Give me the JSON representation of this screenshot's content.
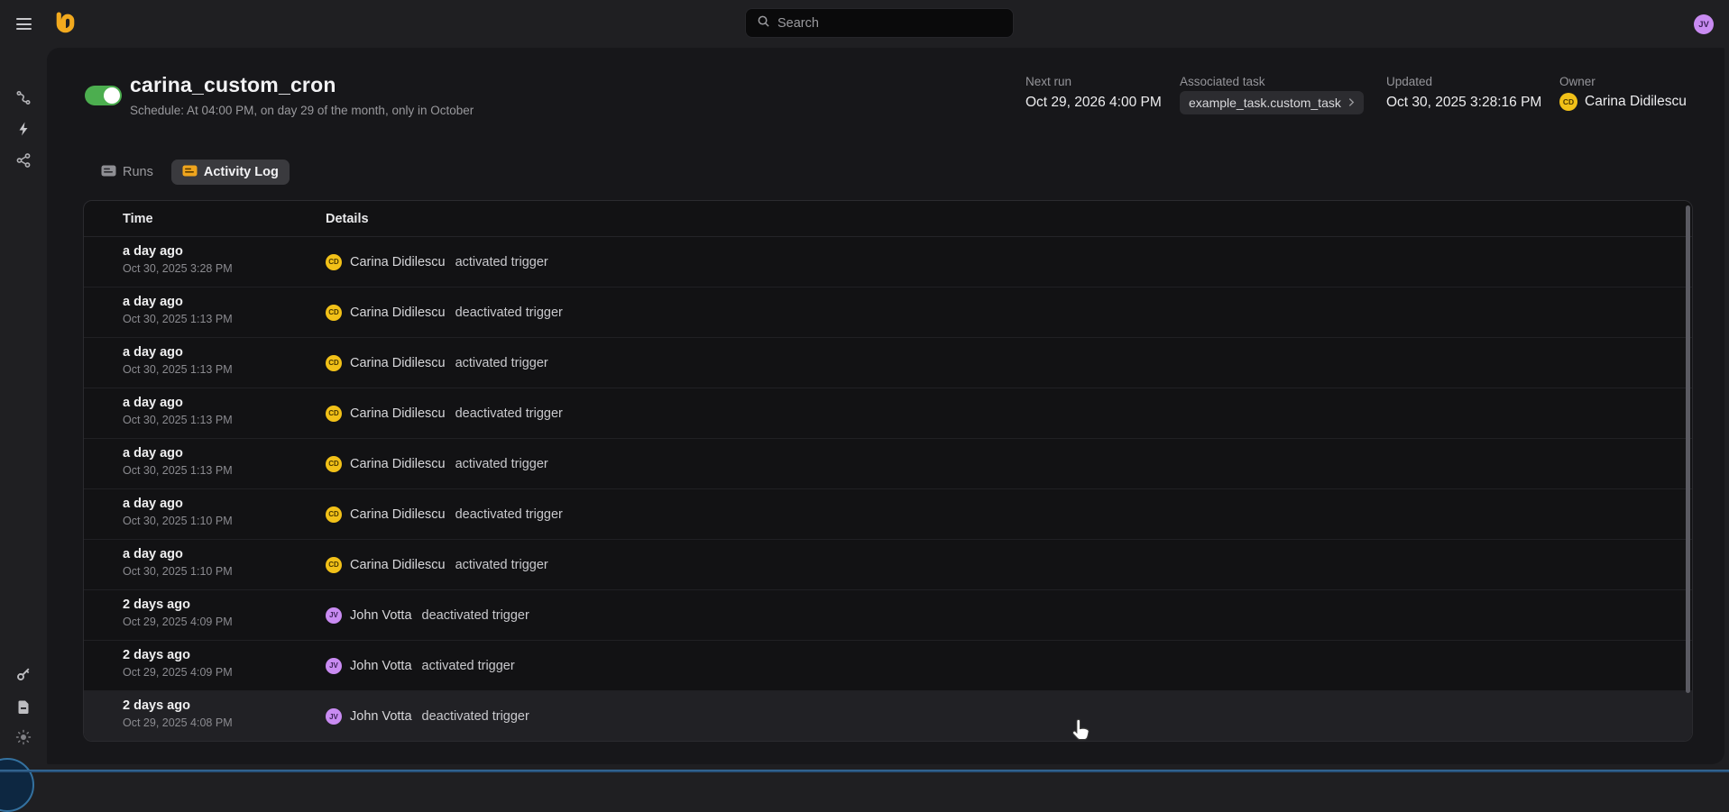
{
  "topbar": {
    "search_placeholder": "Search",
    "user_initials": "JV"
  },
  "sidebar": {
    "top_icons": [
      "route-icon",
      "lightning-icon",
      "share-icon"
    ],
    "bottom_icons": [
      "key-icon",
      "document-icon",
      "sun-icon"
    ]
  },
  "page": {
    "title": "carina_custom_cron",
    "schedule": "Schedule: At 04:00 PM, on day 29 of the month, only in October",
    "trigger_enabled": true,
    "meta": {
      "next_run_label": "Next run",
      "next_run": "Oct 29, 2026 4:00 PM",
      "associated_task_label": "Associated task",
      "associated_task": "example_task.custom_task",
      "updated_label": "Updated",
      "updated": "Oct 30, 2025 3:28:16 PM",
      "owner_label": "Owner",
      "owner": "Carina Didilescu",
      "owner_initials": "CD"
    }
  },
  "tabs": [
    {
      "label": "Runs",
      "active": false
    },
    {
      "label": "Activity Log",
      "active": true
    }
  ],
  "table": {
    "columns": [
      "Time",
      "Details"
    ],
    "rows": [
      {
        "relative": "a day ago",
        "timestamp": "Oct 30, 2025 3:28 PM",
        "user": "Carina Didilescu",
        "initials": "CD",
        "avatar_color": "#f2c118",
        "avatar_text_color": "#4a3800",
        "action": "activated trigger"
      },
      {
        "relative": "a day ago",
        "timestamp": "Oct 30, 2025 1:13 PM",
        "user": "Carina Didilescu",
        "initials": "CD",
        "avatar_color": "#f2c118",
        "avatar_text_color": "#4a3800",
        "action": "deactivated trigger"
      },
      {
        "relative": "a day ago",
        "timestamp": "Oct 30, 2025 1:13 PM",
        "user": "Carina Didilescu",
        "initials": "CD",
        "avatar_color": "#f2c118",
        "avatar_text_color": "#4a3800",
        "action": "activated trigger"
      },
      {
        "relative": "a day ago",
        "timestamp": "Oct 30, 2025 1:13 PM",
        "user": "Carina Didilescu",
        "initials": "CD",
        "avatar_color": "#f2c118",
        "avatar_text_color": "#4a3800",
        "action": "deactivated trigger"
      },
      {
        "relative": "a day ago",
        "timestamp": "Oct 30, 2025 1:13 PM",
        "user": "Carina Didilescu",
        "initials": "CD",
        "avatar_color": "#f2c118",
        "avatar_text_color": "#4a3800",
        "action": "activated trigger"
      },
      {
        "relative": "a day ago",
        "timestamp": "Oct 30, 2025 1:10 PM",
        "user": "Carina Didilescu",
        "initials": "CD",
        "avatar_color": "#f2c118",
        "avatar_text_color": "#4a3800",
        "action": "deactivated trigger"
      },
      {
        "relative": "a day ago",
        "timestamp": "Oct 30, 2025 1:10 PM",
        "user": "Carina Didilescu",
        "initials": "CD",
        "avatar_color": "#f2c118",
        "avatar_text_color": "#4a3800",
        "action": "activated trigger"
      },
      {
        "relative": "2 days ago",
        "timestamp": "Oct 29, 2025 4:09 PM",
        "user": "John Votta",
        "initials": "JV",
        "avatar_color": "#c98bf2",
        "avatar_text_color": "#3c2158",
        "action": "deactivated trigger"
      },
      {
        "relative": "2 days ago",
        "timestamp": "Oct 29, 2025 4:09 PM",
        "user": "John Votta",
        "initials": "JV",
        "avatar_color": "#c98bf2",
        "avatar_text_color": "#3c2158",
        "action": "activated trigger"
      },
      {
        "relative": "2 days ago",
        "timestamp": "Oct 29, 2025 4:08 PM",
        "user": "John Votta",
        "initials": "JV",
        "avatar_color": "#c98bf2",
        "avatar_text_color": "#3c2158",
        "action": "deactivated trigger",
        "hovered": true
      }
    ]
  },
  "colors": {
    "toggle_green": "#4cae4f",
    "avatar_gold": "#f2c118",
    "avatar_purple": "#c98bf2",
    "tab_icon_amber": "#f0a51d",
    "logo_amber": "#f1a91e"
  }
}
